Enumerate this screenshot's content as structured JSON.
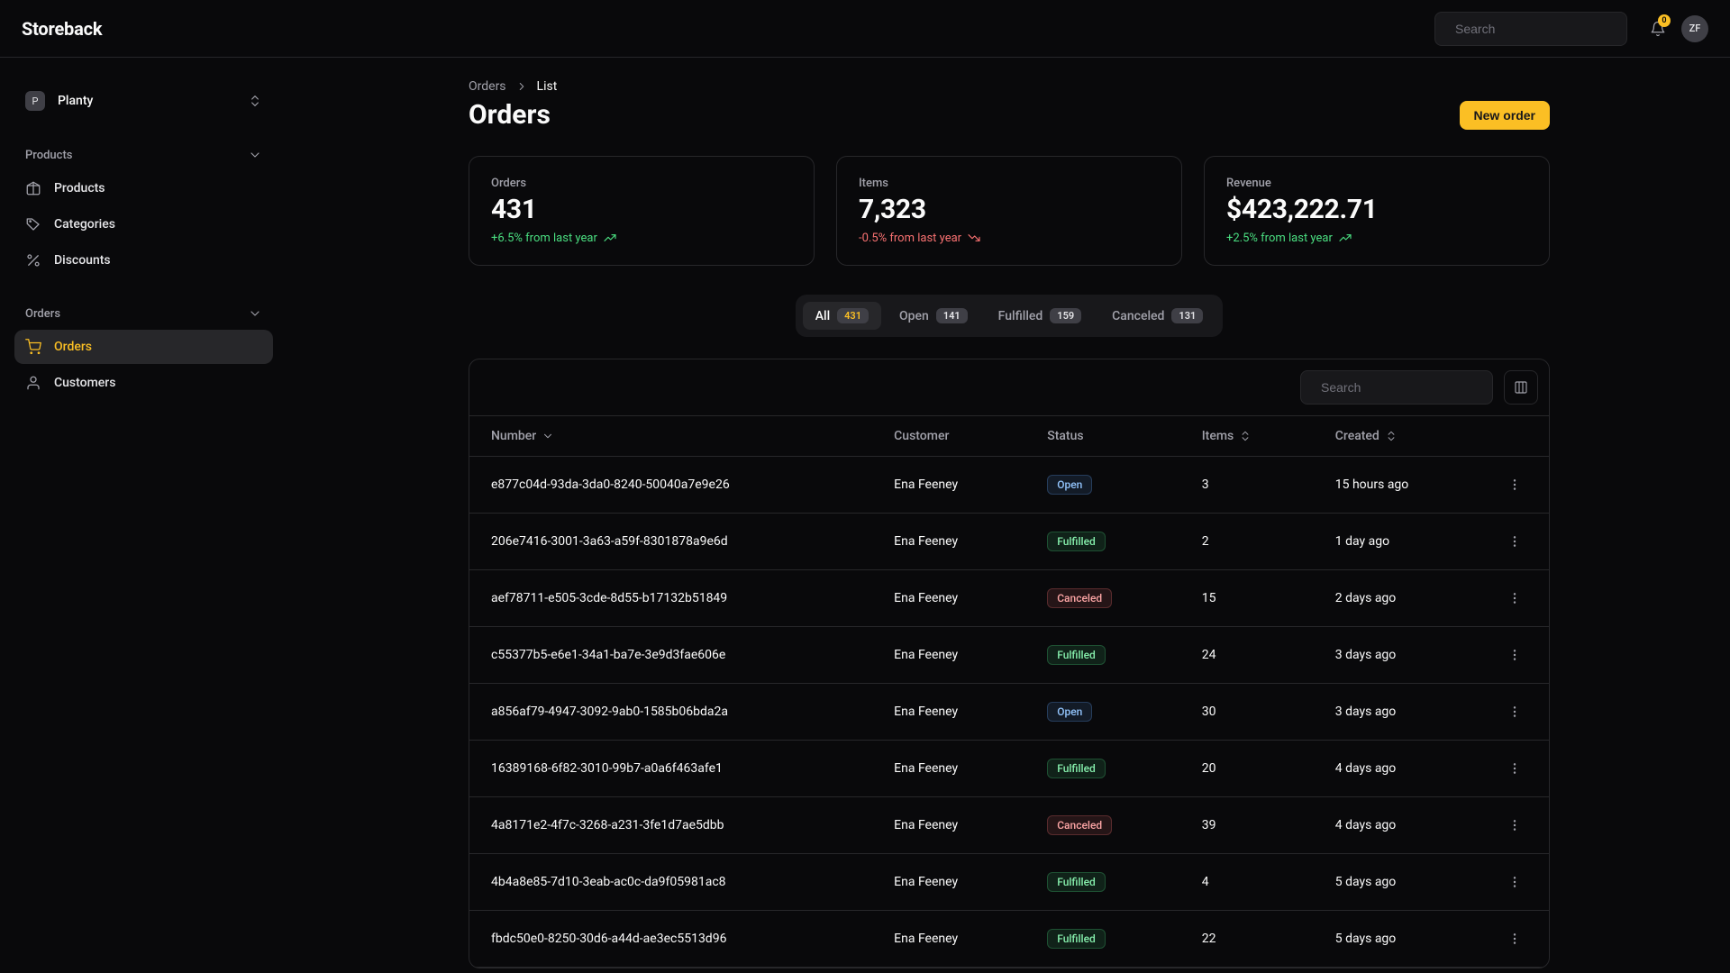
{
  "header": {
    "logo": "Storeback",
    "search_placeholder": "Search",
    "notification_count": "0",
    "user_initials": "ZF"
  },
  "sidebar": {
    "store": {
      "avatar": "P",
      "name": "Planty"
    },
    "sections": [
      {
        "title": "Products",
        "items": [
          {
            "icon": "package",
            "label": "Products"
          },
          {
            "icon": "tag",
            "label": "Categories"
          },
          {
            "icon": "percent",
            "label": "Discounts"
          }
        ]
      },
      {
        "title": "Orders",
        "items": [
          {
            "icon": "cart",
            "label": "Orders",
            "active": true
          },
          {
            "icon": "user",
            "label": "Customers"
          }
        ]
      }
    ]
  },
  "breadcrumb": {
    "root": "Orders",
    "leaf": "List"
  },
  "page_title": "Orders",
  "new_order_label": "New order",
  "stats": [
    {
      "label": "Orders",
      "value": "431",
      "delta": "+6.5% from last year",
      "direction": "up"
    },
    {
      "label": "Items",
      "value": "7,323",
      "delta": "-0.5% from last year",
      "direction": "down"
    },
    {
      "label": "Revenue",
      "value": "$423,222.71",
      "delta": "+2.5% from last year",
      "direction": "up"
    }
  ],
  "tabs": [
    {
      "label": "All",
      "count": "431",
      "active": true
    },
    {
      "label": "Open",
      "count": "141"
    },
    {
      "label": "Fulfilled",
      "count": "159"
    },
    {
      "label": "Canceled",
      "count": "131"
    }
  ],
  "table": {
    "search_placeholder": "Search",
    "columns": {
      "number": "Number",
      "customer": "Customer",
      "status": "Status",
      "items": "Items",
      "created": "Created"
    },
    "rows": [
      {
        "number": "e877c04d-93da-3da0-8240-50040a7e9e26",
        "customer": "Ena Feeney",
        "status": "Open",
        "items": "3",
        "created": "15 hours ago"
      },
      {
        "number": "206e7416-3001-3a63-a59f-8301878a9e6d",
        "customer": "Ena Feeney",
        "status": "Fulfilled",
        "items": "2",
        "created": "1 day ago"
      },
      {
        "number": "aef78711-e505-3cde-8d55-b17132b51849",
        "customer": "Ena Feeney",
        "status": "Canceled",
        "items": "15",
        "created": "2 days ago"
      },
      {
        "number": "c55377b5-e6e1-34a1-ba7e-3e9d3fae606e",
        "customer": "Ena Feeney",
        "status": "Fulfilled",
        "items": "24",
        "created": "3 days ago"
      },
      {
        "number": "a856af79-4947-3092-9ab0-1585b06bda2a",
        "customer": "Ena Feeney",
        "status": "Open",
        "items": "30",
        "created": "3 days ago"
      },
      {
        "number": "16389168-6f82-3010-99b7-a0a6f463afe1",
        "customer": "Ena Feeney",
        "status": "Fulfilled",
        "items": "20",
        "created": "4 days ago"
      },
      {
        "number": "4a8171e2-4f7c-3268-a231-3fe1d7ae5dbb",
        "customer": "Ena Feeney",
        "status": "Canceled",
        "items": "39",
        "created": "4 days ago"
      },
      {
        "number": "4b4a8e85-7d10-3eab-ac0c-da9f05981ac8",
        "customer": "Ena Feeney",
        "status": "Fulfilled",
        "items": "4",
        "created": "5 days ago"
      },
      {
        "number": "fbdc50e0-8250-30d6-a44d-ae3ec5513d96",
        "customer": "Ena Feeney",
        "status": "Fulfilled",
        "items": "22",
        "created": "5 days ago"
      }
    ]
  },
  "colors": {
    "accent": "#fbbf24",
    "up": "#4ade80",
    "down": "#f87171"
  }
}
